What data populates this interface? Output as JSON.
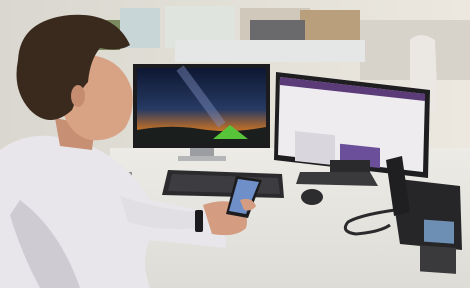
{
  "photo": {
    "subject": "person",
    "objects": [
      {
        "name": "left-monitor",
        "wallpaper": "night-sky-with-tent"
      },
      {
        "name": "right-monitor",
        "content": "webpage"
      },
      {
        "name": "keyboard"
      },
      {
        "name": "mouse"
      },
      {
        "name": "desk-phone"
      },
      {
        "name": "smartphone"
      },
      {
        "name": "wristwatch"
      }
    ],
    "colors": {
      "wall": "#e9e5dc",
      "desk": "#e7e6e1",
      "shirt": "#e8e6ea",
      "hair": "#3a2a1e",
      "skin": "#d8a285",
      "sky_top": "#101b35",
      "sky_glow": "#e58a2c",
      "tent": "#58c43a",
      "webpage_header": "#5b3b78"
    }
  }
}
